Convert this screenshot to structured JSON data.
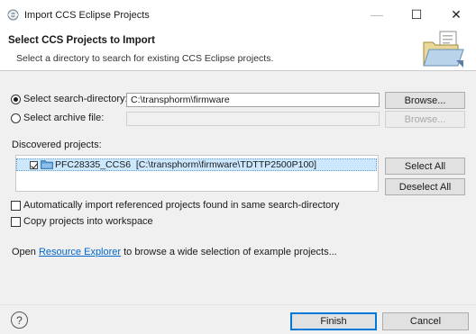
{
  "window": {
    "title": "Import CCS Eclipse Projects",
    "minimize_glyph": "—",
    "maximize_glyph": "☐",
    "close_glyph": "✕"
  },
  "header": {
    "title": "Select CCS Projects to Import",
    "description": "Select a directory to search for existing CCS Eclipse projects."
  },
  "source": {
    "directory_label": "Select search-directory:",
    "directory_selected": true,
    "directory_value": "C:\\transphorm\\firmware",
    "directory_browse": "Browse...",
    "archive_label": "Select archive file:",
    "archive_selected": false,
    "archive_value": "",
    "archive_browse": "Browse..."
  },
  "discovered": {
    "label": "Discovered projects:",
    "projects": [
      {
        "name": "PFC28335_CCS6",
        "path": "[C:\\transphorm\\firmware\\TDTTP2500P100]",
        "checked": true
      }
    ],
    "select_all": "Select All",
    "deselect_all": "Deselect All"
  },
  "options": {
    "auto_import_label": "Automatically import referenced projects found in same search-directory",
    "auto_import_checked": false,
    "copy_label": "Copy projects into workspace",
    "copy_checked": false
  },
  "resource": {
    "prefix": "Open ",
    "link": "Resource Explorer",
    "suffix": " to browse a wide selection of example projects..."
  },
  "footer": {
    "help_glyph": "?",
    "finish": "Finish",
    "cancel": "Cancel"
  },
  "colors": {
    "accent": "#0078d7",
    "link": "#0066cc",
    "selection": "#cce8ff"
  },
  "icons": {
    "app": "eclipse-app-icon",
    "wizard": "folder-import-wizard-icon",
    "project": "project-folder-icon",
    "help": "help-icon"
  }
}
